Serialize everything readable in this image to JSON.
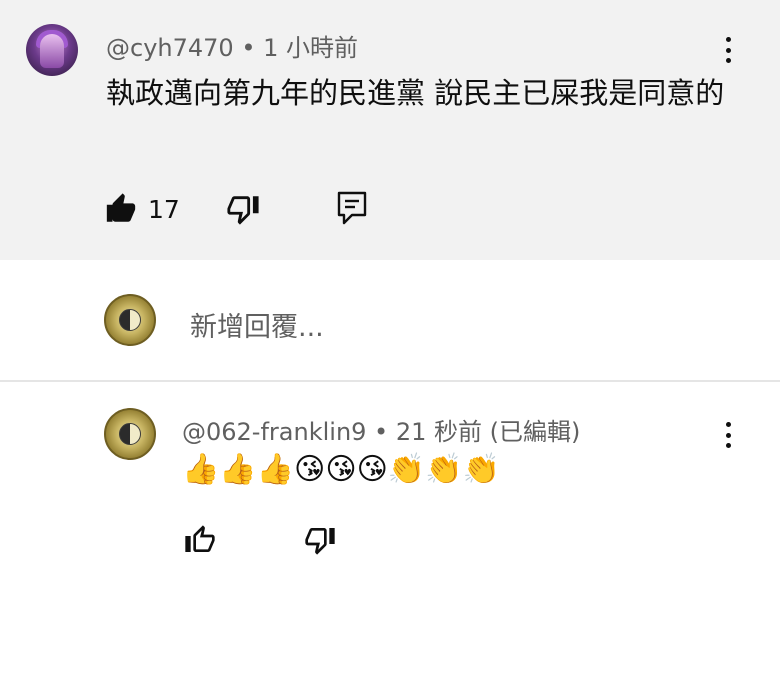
{
  "parent_comment": {
    "author": "@cyh7470",
    "separator": " • ",
    "time": "1 小時前",
    "text": "執政邁向第九年的民進黨 說民主已屎我是同意的",
    "like_count": "17"
  },
  "composer": {
    "placeholder": "新增回覆..."
  },
  "reply_comment": {
    "author": "@062-franklin9",
    "separator": " • ",
    "time": "21 秒前",
    "edited": "(已編輯)",
    "text": "👍👍👍😘😘😘👏👏👏"
  }
}
